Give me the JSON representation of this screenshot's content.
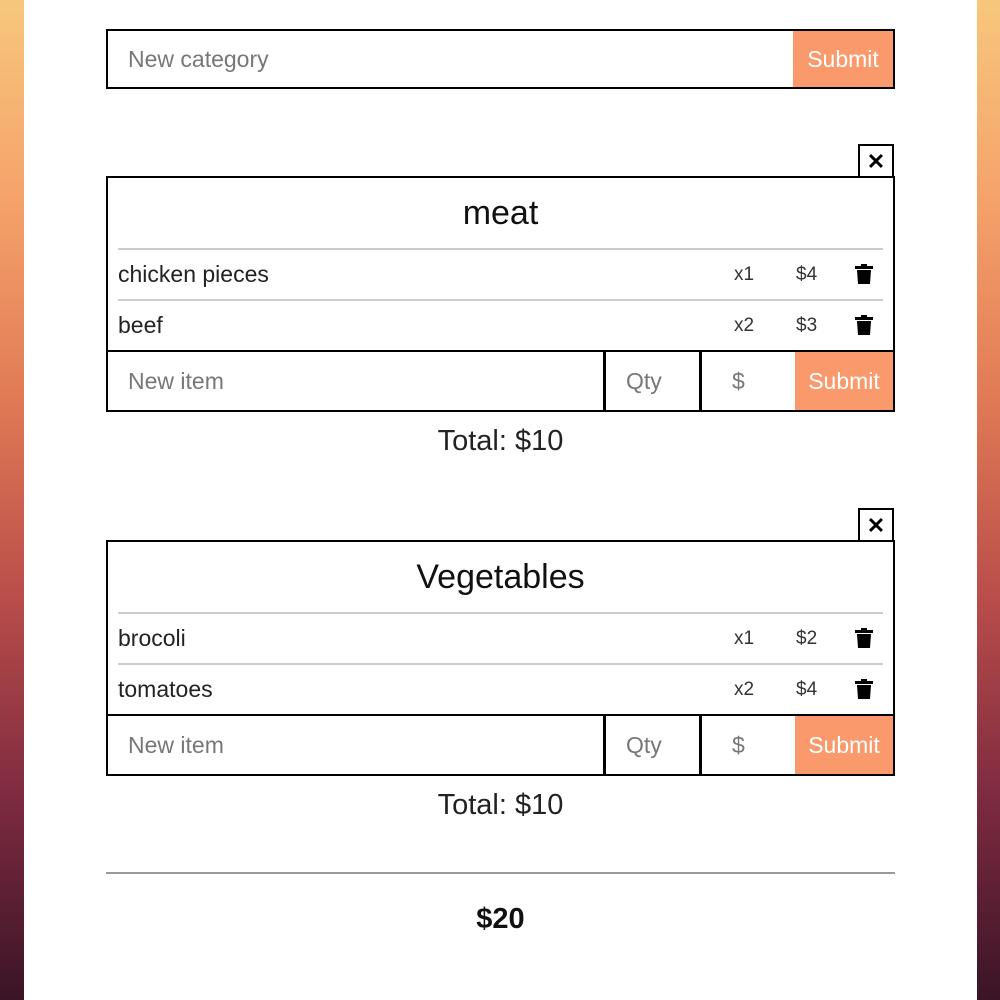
{
  "new_category": {
    "placeholder": "New category",
    "submit_label": "Submit"
  },
  "categories": [
    {
      "title": "meat",
      "close_glyph": "✕",
      "items": [
        {
          "name": "chicken pieces",
          "qty": "x1",
          "price": "$4"
        },
        {
          "name": "beef",
          "qty": "x2",
          "price": "$3"
        }
      ],
      "form": {
        "name_placeholder": "New item",
        "qty_placeholder": "Qty",
        "price_placeholder": "$",
        "submit_label": "Submit"
      },
      "total": "Total: $10"
    },
    {
      "title": "Vegetables",
      "close_glyph": "✕",
      "items": [
        {
          "name": "brocoli",
          "qty": "x1",
          "price": "$2"
        },
        {
          "name": "tomatoes",
          "qty": "x2",
          "price": "$4"
        }
      ],
      "form": {
        "name_placeholder": "New item",
        "qty_placeholder": "Qty",
        "price_placeholder": "$",
        "submit_label": "Submit"
      },
      "total": "Total: $10"
    }
  ],
  "grand_total": "$20",
  "colors": {
    "accent": "#fa9a6c",
    "border": "#000000"
  }
}
